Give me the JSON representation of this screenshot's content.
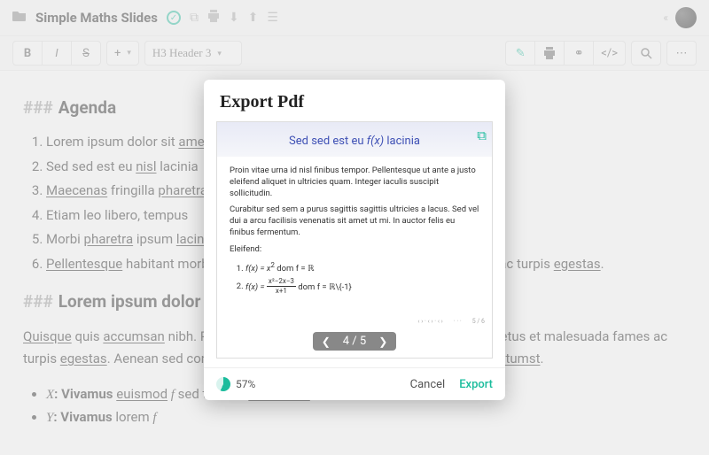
{
  "topbar": {
    "title": "Simple Maths Slides",
    "collapse": "«"
  },
  "toolbar": {
    "bold": "B",
    "italic": "I",
    "strike": "S",
    "plus": "+",
    "header_select": "H3 Header 3"
  },
  "content": {
    "h3_1": "Agenda",
    "hashes": "###",
    "list": [
      {
        "pre": "Lorem ipsum dolor sit ",
        "u": "amet",
        "post": ""
      },
      {
        "pre": "Sed sed est eu ",
        "u": "nisl",
        "mid": " lacinia",
        "post": ""
      },
      {
        "pre": "",
        "u": "Maecenas",
        "mid": " fringilla ",
        "u2": "pharetra",
        "post": ""
      },
      {
        "pre": "Etiam leo libero, tempus ",
        "u": "",
        "post": ""
      },
      {
        "pre": "Morbi ",
        "u": "pharetra",
        "mid": " ipsum ",
        "u2": "lacinia",
        "post": ""
      },
      {
        "pre": "",
        "u": "Pellentesque",
        "mid": " habitant morbi tristique senectus et netus et malesuada fames ac turpis ",
        "u2": "egestas",
        "post": "."
      }
    ],
    "h3_2": "Lorem ipsum dolor",
    "para_pre": "Quisque",
    "para_mid1": " quis ",
    "para_u1": "accumsan",
    "para_mid2": " nibh. Pellentesque habitant morbi tristique senectus et netus et malesuada fames ac turpis ",
    "para_u2": "egestas",
    "para_mid3": ". Aenean sed condimentum diam, ac viverra lacus. In quis platea ",
    "para_u3": "dictumst",
    "para_end": ".",
    "bullet1_pre": "X",
    "bullet1_b": ": Vivamus",
    "bullet1_u1": "euismod",
    "bullet1_mid": " ",
    "bullet1_var": "f",
    "bullet1_mid2": " sed tellus a ",
    "bullet1_u2": "accumsan",
    "bullet2_pre": "Y",
    "bullet2_b": ": Vivamus",
    "bullet2_mid": " lorem ",
    "bullet2_var": "f"
  },
  "modal": {
    "title": "Export Pdf",
    "slide_title_pre": "Sed sed est eu ",
    "slide_title_fx": "f(x)",
    "slide_title_post": " lacinia",
    "p1": "Proin vitae urna id nisl finibus tempor. Pellentesque ut ante a justo eleifend aliquet in ultricies quam. Integer iaculis suscipit sollicitudin.",
    "p2": "Curabitur sed sem a purus sagittis sagittis ultricies a lacus. Sed vel dui a arcu facilisis venenatis sit amet ut mi. In auctor felis eu finibus fermentum.",
    "p3": "Eleifend:",
    "eq1_a": "f(x) = x",
    "eq1_sup": "2",
    "eq1_b": " dom f = ℝ",
    "eq2_a": "f(x) = ",
    "eq2_frac_top": "x²−2x−3",
    "eq2_frac_bot": "x+1",
    "eq2_b": " dom f = ℝ\\{-1}",
    "footer_a": "‹ › · ‹ › · ‹ ›",
    "footer_b": "· · ·",
    "footer_c": "5 / 6",
    "pager_prev": "❮",
    "pager_label": "4 / 5",
    "pager_next": "❯",
    "progress": "57%",
    "cancel": "Cancel",
    "export": "Export"
  }
}
